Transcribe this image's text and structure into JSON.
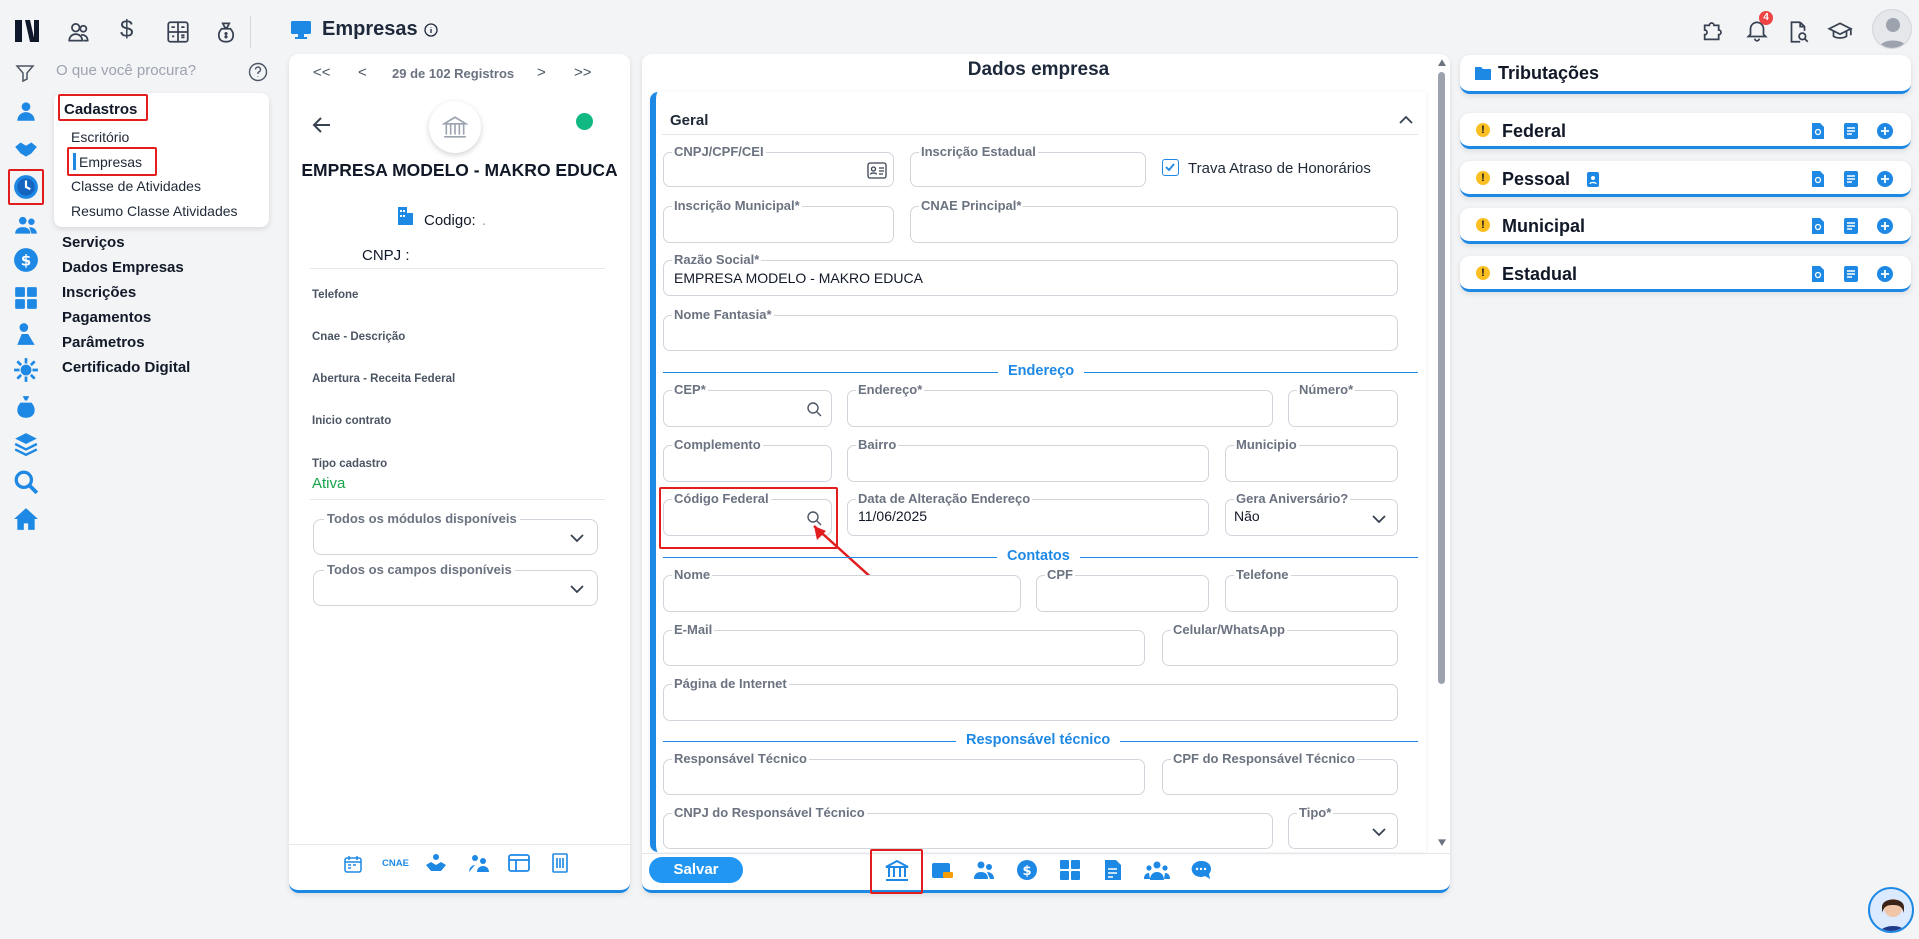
{
  "header": {
    "title": "Empresas",
    "notifications_count": "4"
  },
  "sidebar": {
    "search_placeholder": "O que você procura?",
    "section_title": "Cadastros",
    "sub_items": [
      "Escritório",
      "Empresas",
      "Classe de Atividades",
      "Resumo Classe Atividades"
    ],
    "main_items": [
      "Serviços",
      "Dados Empresas",
      "Inscrições",
      "Pagamentos",
      "Parâmetros",
      "Certificado Digital"
    ]
  },
  "record_nav": {
    "first": "<<",
    "prev": "<",
    "label": "29 de 102 Registros",
    "next": ">",
    "last": ">>"
  },
  "company": {
    "name": "EMPRESA MODELO - MAKRO EDUCA",
    "codigo_label": "Codigo:",
    "codigo_value": ".",
    "cnpj_label": "CNPJ :",
    "info": [
      {
        "label": "Telefone",
        "value": ""
      },
      {
        "label": "Cnae - Descrição",
        "value": ""
      },
      {
        "label": "Abertura - Receita Federal",
        "value": ""
      },
      {
        "label": "Inicio contrato",
        "value": ""
      },
      {
        "label": "Tipo cadastro",
        "value": "Ativa"
      }
    ],
    "modules_select": "Todos os módulos disponíveis",
    "fields_select": "Todos os campos disponíveis",
    "bottom_icons": [
      "calendar-icon",
      "CNAE",
      "handshake-icon",
      "people-icon",
      "table-icon",
      "building-icon"
    ]
  },
  "form": {
    "title": "Dados empresa",
    "section_geral": "Geral",
    "fields": {
      "cnpj": {
        "label": "CNPJ/CPF/CEI",
        "value": ""
      },
      "inscricao_estadual": {
        "label": "Inscrição Estadual",
        "value": ""
      },
      "trava": {
        "label": "Trava Atraso de Honorários",
        "checked": true
      },
      "inscricao_municipal": {
        "label": "Inscrição Municipal*",
        "value": ""
      },
      "cnae_principal": {
        "label": "CNAE Principal*",
        "value": ""
      },
      "razao_social": {
        "label": "Razão Social*",
        "value": "EMPRESA MODELO  - MAKRO EDUCA"
      },
      "nome_fantasia": {
        "label": "Nome Fantasia*",
        "value": ""
      },
      "cep": {
        "label": "CEP*",
        "value": ""
      },
      "endereco": {
        "label": "Endereço*",
        "value": ""
      },
      "numero": {
        "label": "Número*",
        "value": ""
      },
      "complemento": {
        "label": "Complemento",
        "value": ""
      },
      "bairro": {
        "label": "Bairro",
        "value": ""
      },
      "municipio": {
        "label": "Municipio",
        "value": ""
      },
      "codigo_federal": {
        "label": "Código Federal",
        "value": ""
      },
      "data_alteracao": {
        "label": "Data de Alteração Endereço",
        "value": "11/06/2025"
      },
      "gera_aniversario": {
        "label": "Gera Aniversário?",
        "value": "Não"
      },
      "nome": {
        "label": "Nome",
        "value": ""
      },
      "cpf": {
        "label": "CPF",
        "value": ""
      },
      "telefone": {
        "label": "Telefone",
        "value": ""
      },
      "email": {
        "label": "E-Mail",
        "value": ""
      },
      "celular": {
        "label": "Celular/WhatsApp",
        "value": ""
      },
      "pagina": {
        "label": "Página de Internet",
        "value": ""
      },
      "resp_tecnico": {
        "label": "Responsável Técnico",
        "value": ""
      },
      "cpf_resp": {
        "label": "CPF do Responsável Técnico",
        "value": ""
      },
      "cnpj_resp": {
        "label": "CNPJ do Responsável Técnico",
        "value": ""
      },
      "tipo": {
        "label": "Tipo*",
        "value": ""
      }
    },
    "section_endereco": "Endereço",
    "section_contatos": "Contatos",
    "section_responsavel": "Responsável técnico",
    "save_label": "Salvar"
  },
  "tributacoes": {
    "title": "Tributações",
    "items": [
      "Federal",
      "Pessoal",
      "Municipal",
      "Estadual"
    ]
  },
  "colors": {
    "accent": "#1e88e5",
    "highlight": "#e11d1d",
    "ativa": "#16a34a"
  }
}
